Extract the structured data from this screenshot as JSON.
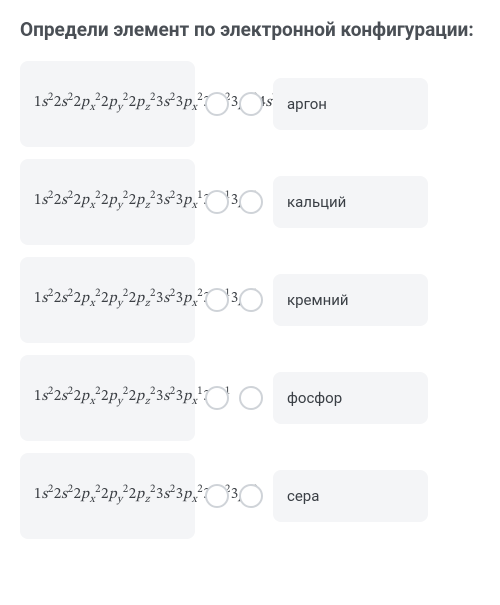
{
  "title": "Определи элемент по электронной конфигурации:",
  "left": [
    {
      "segments": [
        {
          "c": "1",
          "o": "s",
          "s": "2"
        },
        {
          "c": "2",
          "o": "s",
          "s": "2"
        },
        {
          "c": "2",
          "o": "p",
          "sb": "x",
          "s": "2"
        },
        {
          "c": "2",
          "o": "p",
          "sb": "y",
          "s": "2"
        },
        {
          "c": "2",
          "o": "p",
          "sb": "z",
          "s": "2"
        },
        {
          "c": "3",
          "o": "s",
          "s": "2"
        },
        {
          "c": "3",
          "o": "p",
          "sb": "x",
          "s": "2"
        },
        {
          "c": "3",
          "o": "p",
          "sb": "y",
          "s": "2"
        },
        {
          "c": "3",
          "o": "p",
          "sb": "z",
          "s": "2"
        },
        {
          "c": "4",
          "o": "s",
          "s": "2"
        }
      ]
    },
    {
      "segments": [
        {
          "c": "1",
          "o": "s",
          "s": "2"
        },
        {
          "c": "2",
          "o": "s",
          "s": "2"
        },
        {
          "c": "2",
          "o": "p",
          "sb": "x",
          "s": "2"
        },
        {
          "c": "2",
          "o": "p",
          "sb": "y",
          "s": "2"
        },
        {
          "c": "2",
          "o": "p",
          "sb": "z",
          "s": "2"
        },
        {
          "c": "3",
          "o": "s",
          "s": "2"
        },
        {
          "c": "3",
          "o": "p",
          "sb": "x",
          "s": "1"
        },
        {
          "c": "3",
          "o": "p",
          "sb": "y",
          "s": "1"
        },
        {
          "c": "3",
          "o": "p",
          "sb": "z",
          "s": "1"
        }
      ]
    },
    {
      "segments": [
        {
          "c": "1",
          "o": "s",
          "s": "2"
        },
        {
          "c": "2",
          "o": "s",
          "s": "2"
        },
        {
          "c": "2",
          "o": "p",
          "sb": "x",
          "s": "2"
        },
        {
          "c": "2",
          "o": "p",
          "sb": "y",
          "s": "2"
        },
        {
          "c": "2",
          "o": "p",
          "sb": "z",
          "s": "2"
        },
        {
          "c": "3",
          "o": "s",
          "s": "2"
        },
        {
          "c": "3",
          "o": "p",
          "sb": "x",
          "s": "2"
        },
        {
          "c": "3",
          "o": "p",
          "sb": "y",
          "s": "1"
        },
        {
          "c": "3",
          "o": "p",
          "sb": "z",
          "s": "1"
        }
      ]
    },
    {
      "segments": [
        {
          "c": "1",
          "o": "s",
          "s": "2"
        },
        {
          "c": "2",
          "o": "s",
          "s": "2"
        },
        {
          "c": "2",
          "o": "p",
          "sb": "x",
          "s": "2"
        },
        {
          "c": "2",
          "o": "p",
          "sb": "y",
          "s": "2"
        },
        {
          "c": "2",
          "o": "p",
          "sb": "z",
          "s": "2"
        },
        {
          "c": "3",
          "o": "s",
          "s": "2"
        },
        {
          "c": "3",
          "o": "p",
          "sb": "x",
          "s": "1"
        },
        {
          "c": "3",
          "o": "p",
          "sb": "y",
          "s": "1"
        }
      ]
    },
    {
      "segments": [
        {
          "c": "1",
          "o": "s",
          "s": "2"
        },
        {
          "c": "2",
          "o": "s",
          "s": "2"
        },
        {
          "c": "2",
          "o": "p",
          "sb": "x",
          "s": "2"
        },
        {
          "c": "2",
          "o": "p",
          "sb": "y",
          "s": "2"
        },
        {
          "c": "2",
          "o": "p",
          "sb": "z",
          "s": "2"
        },
        {
          "c": "3",
          "o": "s",
          "s": "2"
        },
        {
          "c": "3",
          "o": "p",
          "sb": "x",
          "s": "2"
        },
        {
          "c": "3",
          "o": "p",
          "sb": "y",
          "s": "2"
        },
        {
          "c": "3",
          "o": "p",
          "sb": "z",
          "s": "2"
        }
      ]
    }
  ],
  "right": [
    {
      "label": "аргон"
    },
    {
      "label": "кальций"
    },
    {
      "label": "кремний"
    },
    {
      "label": "фосфор"
    },
    {
      "label": "сера"
    }
  ]
}
